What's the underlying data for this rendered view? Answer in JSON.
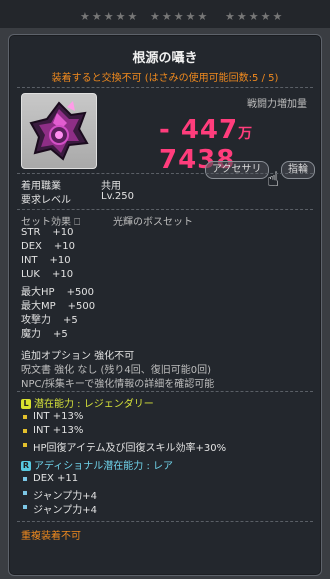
{
  "background_stars": [
    "★★★★★",
    "★★★★★",
    "★★★★★"
  ],
  "item": {
    "name": "根源の囁き",
    "trade_notice": "装着すると交換不可 (はさみの使用可能回数:5 / 5)",
    "combat_power_label": "戦闘力増加量",
    "combat_power_value_prefix": "- 447",
    "combat_power_man": "万",
    "combat_power_value_suffix": "7438",
    "category_button": "アクセサリ",
    "ring_button": "指輪",
    "job_label": "着用職業",
    "job_value": "共用",
    "level_label": "要求レベル",
    "level_value": "Lv.250",
    "set_label": "セット効果",
    "set_value": "光輝のボスセット"
  },
  "stats": [
    {
      "name": "STR",
      "value": "+10"
    },
    {
      "name": "DEX",
      "value": "+10"
    },
    {
      "name": "INT",
      "value": "+10"
    },
    {
      "name": "LUK",
      "value": "+10"
    },
    {
      "name": "最大HP",
      "value": "+500"
    },
    {
      "name": "最大MP",
      "value": "+500"
    },
    {
      "name": "攻撃力",
      "value": "+5"
    },
    {
      "name": "魔力",
      "value": "+5"
    }
  ],
  "extra": {
    "additional_option": "追加オプション 強化不可",
    "scroll_info": "呪文書 強化 なし (残り4回、復旧可能0回)",
    "npc_note": "NPC/採集キーで強化情報の詳細を確認可能"
  },
  "potential": {
    "badge": "L",
    "title": "潜在能力 : レジェンダリー",
    "lines": [
      "INT +13%",
      "INT +13%",
      "HP回復アイテム及び回復スキル効率+30%"
    ]
  },
  "additional_potential": {
    "badge": "R",
    "title": "アディショナル潜在能力 : レア",
    "lines": [
      "DEX +11",
      "ジャンプ力+4",
      "ジャンプ力+4"
    ]
  },
  "footer": "重複装着不可",
  "colors": {
    "title": "#f0f0f0",
    "warning": "#f08a1e",
    "combat_power": "#ff3d7c",
    "legendary": "#d6e23a",
    "rare": "#6fd3ea"
  }
}
